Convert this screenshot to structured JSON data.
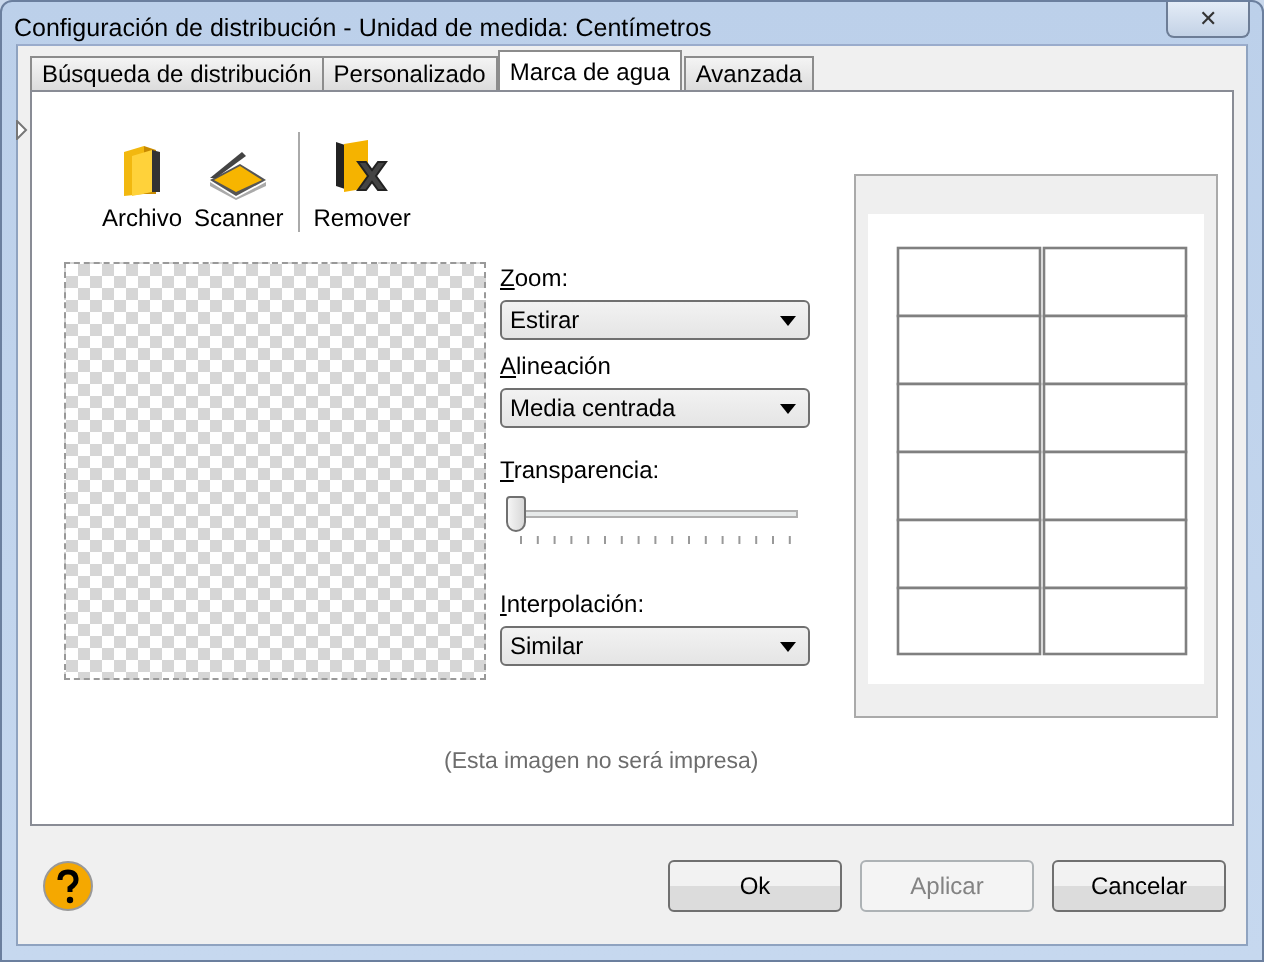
{
  "window": {
    "title": "Configuración de distribución - Unidad de medida: Centímetros",
    "close": "✕"
  },
  "tabs": [
    {
      "label": "Búsqueda de distribución",
      "selected": false
    },
    {
      "label": "Personalizado",
      "selected": false
    },
    {
      "label": "Marca de agua",
      "selected": true
    },
    {
      "label": "Avanzada",
      "selected": false
    }
  ],
  "toolbar": [
    {
      "kind": "file",
      "label": "Archivo"
    },
    {
      "kind": "scanner",
      "label": "Scanner"
    },
    {
      "kind": "separator"
    },
    {
      "kind": "remove",
      "label": "Remover"
    }
  ],
  "controls": [
    {
      "kind": "dropdown",
      "label": "Zoom:",
      "value": "Estirar"
    },
    {
      "kind": "dropdown",
      "label": "Alineación",
      "value": "Media centrada"
    },
    {
      "kind": "slider",
      "label": "Transparencia:",
      "level": 0
    },
    {
      "kind": "dropdown",
      "label": "Interpolación:",
      "value": "Similar"
    }
  ],
  "caption": "(Esta imagen no será impresa)",
  "buttons": [
    {
      "label": "Ok",
      "disabled": false
    },
    {
      "label": "Aplicar",
      "disabled": true
    },
    {
      "label": "Cancelar",
      "disabled": false
    }
  ]
}
